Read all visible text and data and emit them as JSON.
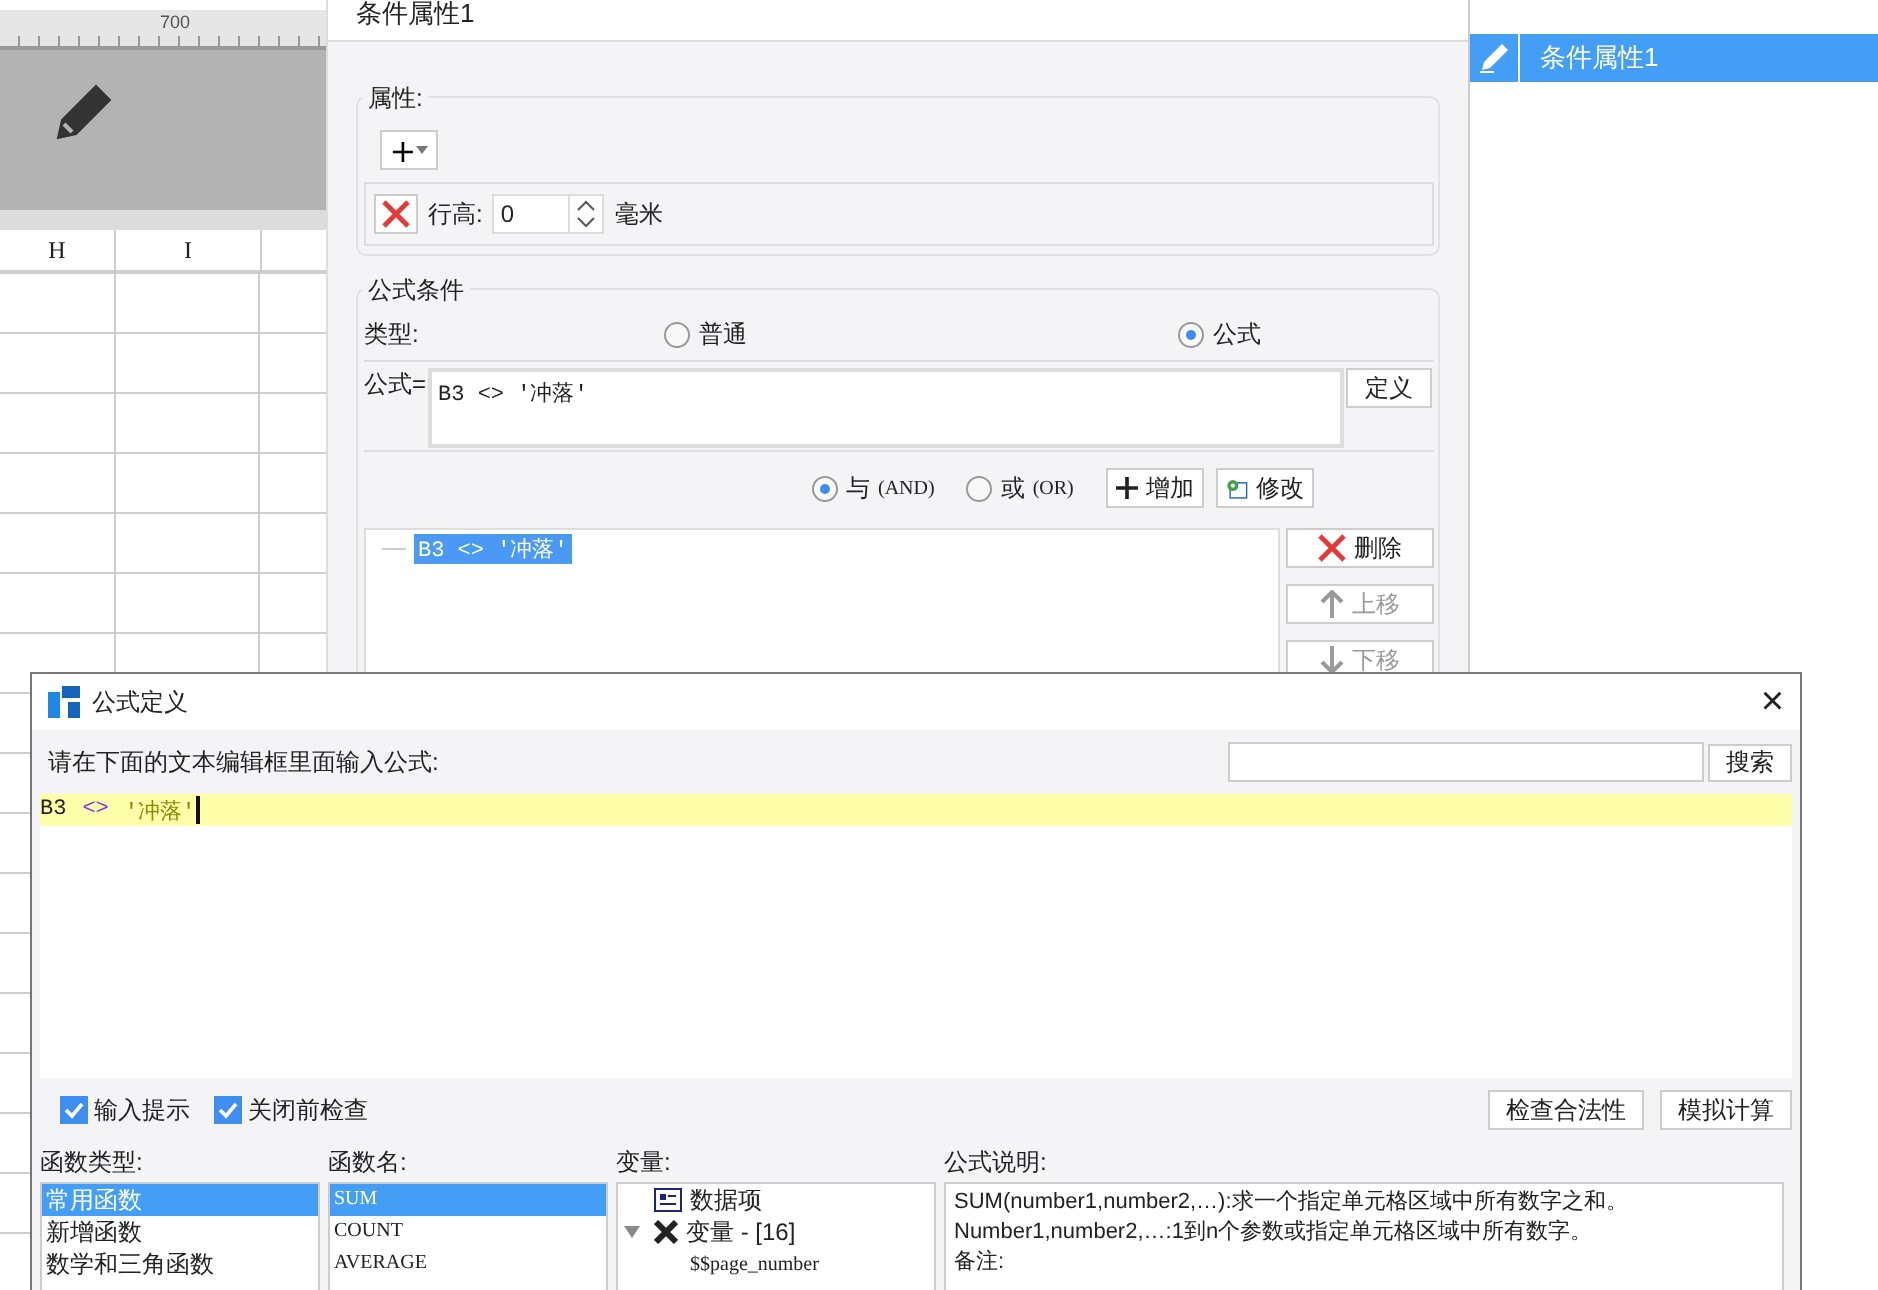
{
  "sheet": {
    "ruler_label": "700",
    "columns": [
      "H",
      "I"
    ]
  },
  "condition_panel": {
    "title": "条件属性1",
    "attributes": {
      "label": "属性:",
      "add_button": "+",
      "row": {
        "label": "行高:",
        "value": "0",
        "unit": "毫米"
      }
    },
    "formula_condition": {
      "label": "公式条件",
      "type_label": "类型:",
      "types": [
        {
          "label": "普通",
          "selected": false
        },
        {
          "label": "公式",
          "selected": true
        }
      ],
      "formula_label": "公式=",
      "formula_value": "B3 <> '冲落'",
      "define_button": "定义",
      "logic": [
        {
          "label": "与",
          "suffix": "(AND)",
          "selected": true
        },
        {
          "label": "或",
          "suffix": "(OR)",
          "selected": false
        }
      ],
      "add_button": "增加",
      "modify_button": "修改",
      "conditions": [
        {
          "text": "B3 <> '冲落'",
          "selected": true
        }
      ],
      "side_buttons": [
        {
          "label": "删除",
          "kind": "delete",
          "disabled": false
        },
        {
          "label": "上移",
          "kind": "up",
          "disabled": true
        },
        {
          "label": "下移",
          "kind": "down",
          "disabled": true
        }
      ]
    }
  },
  "property_list": {
    "items": [
      {
        "label": "条件属性1",
        "selected": true
      }
    ]
  },
  "dialog": {
    "title": "公式定义",
    "close": "×",
    "prompt": "请在下面的文本编辑框里面输入公式:",
    "search_button": "搜索",
    "editor_tokens": [
      {
        "text": "B3",
        "kind": "ref"
      },
      {
        "text": "<>",
        "kind": "op"
      },
      {
        "text": "'冲落'",
        "kind": "string"
      }
    ],
    "checkboxes": [
      {
        "label": "输入提示",
        "checked": true
      },
      {
        "label": "关闭前检查",
        "checked": true
      }
    ],
    "buttons": [
      "检查合法性",
      "模拟计算"
    ],
    "function_types": {
      "label": "函数类型:",
      "items": [
        {
          "label": "常用函数",
          "selected": true
        },
        {
          "label": "新增函数",
          "selected": false
        },
        {
          "label": "数学和三角函数",
          "selected": false
        }
      ]
    },
    "function_names": {
      "label": "函数名:",
      "items": [
        {
          "label": "SUM",
          "selected": true
        },
        {
          "label": "COUNT",
          "selected": false
        },
        {
          "label": "AVERAGE",
          "selected": false
        }
      ]
    },
    "variables": {
      "label": "变量:",
      "items": [
        {
          "label": "数据项",
          "kind": "data",
          "expanded": false
        },
        {
          "label": "变量 - [16]",
          "kind": "var",
          "expanded": true,
          "children": [
            {
              "label": "$$page_number"
            }
          ]
        }
      ]
    },
    "description": {
      "label": "公式说明:",
      "lines": [
        "SUM(number1,number2,…):求一个指定单元格区域中所有数字之和。",
        "Number1,number2,…:1到n个参数或指定单元格区域中所有数字。",
        "备注:"
      ]
    }
  }
}
